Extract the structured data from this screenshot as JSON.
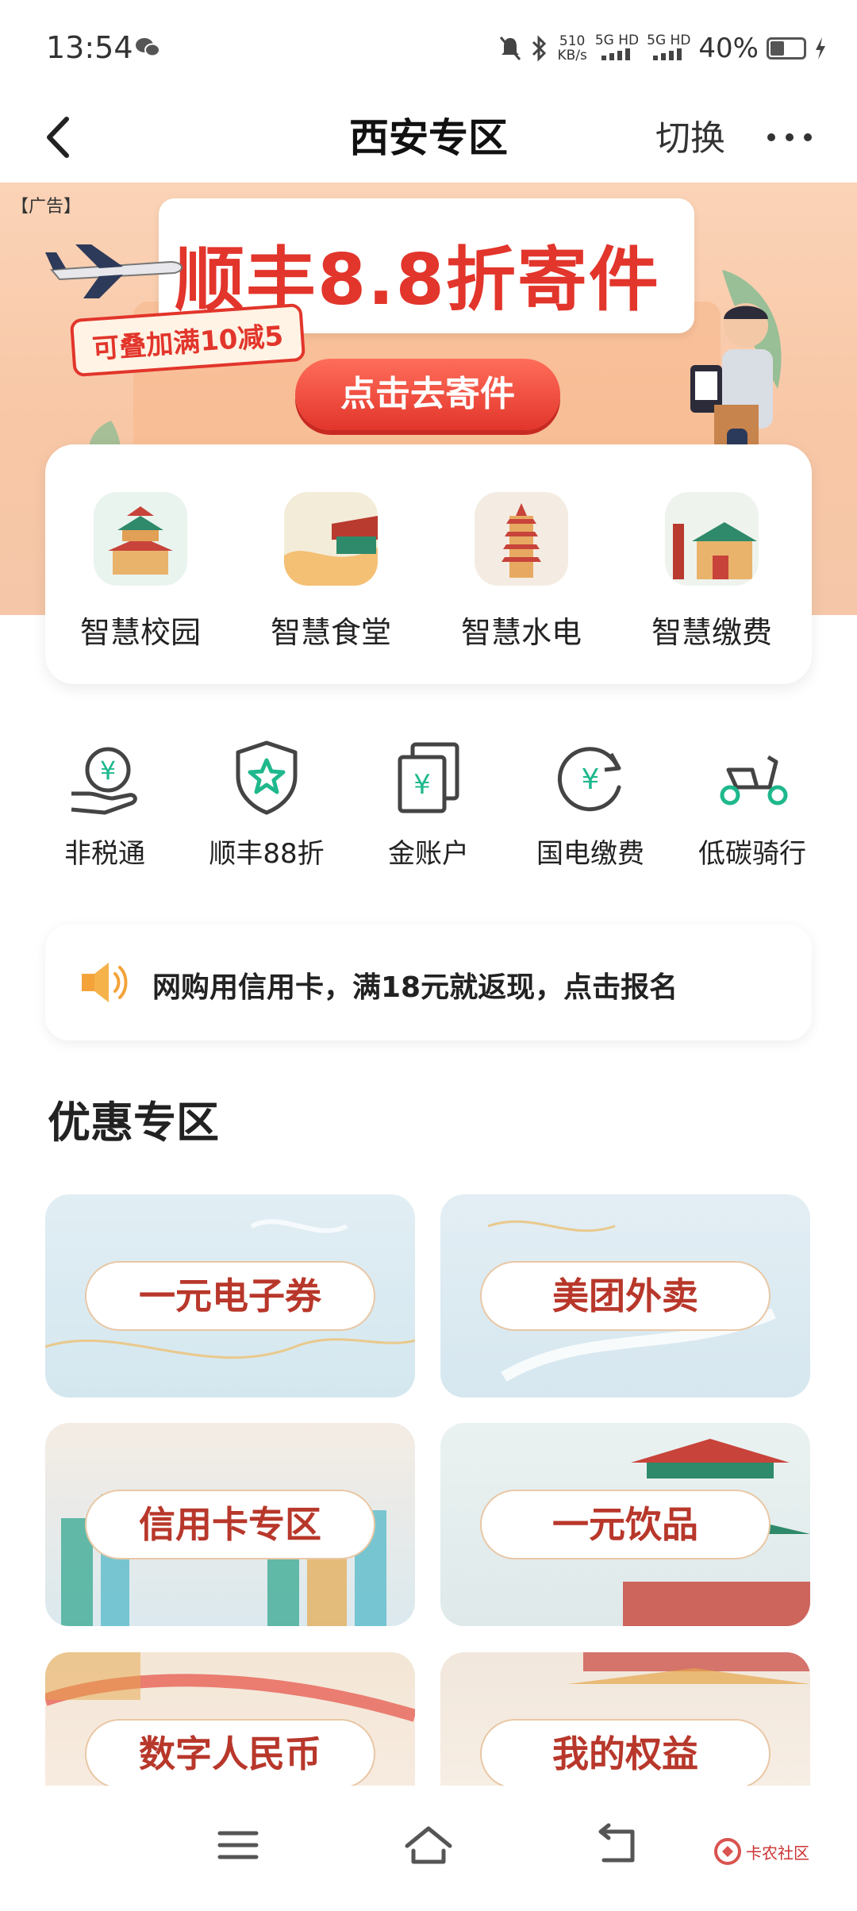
{
  "status_bar": {
    "time": "13:54",
    "net_speed_top": "510",
    "net_speed_bottom": "KB/s",
    "sig1": "5G HD",
    "sig2": "5G HD",
    "battery_pct": "40%"
  },
  "nav": {
    "title": "西安专区",
    "switch_label": "切换"
  },
  "banner": {
    "ad_tag": "【广告】",
    "title": "顺丰8.8折寄件",
    "badge": "可叠加满10减5",
    "cta": "点击去寄件"
  },
  "smart_services": [
    {
      "label": "智慧校园",
      "icon": "pagoda-campus-icon"
    },
    {
      "label": "智慧食堂",
      "icon": "palace-roof-icon"
    },
    {
      "label": "智慧水电",
      "icon": "wild-goose-pagoda-icon"
    },
    {
      "label": "智慧缴费",
      "icon": "city-gate-icon"
    }
  ],
  "quick_actions": [
    {
      "label": "非税通",
      "icon": "yuan-hand-icon"
    },
    {
      "label": "顺丰88折",
      "icon": "star-shield-icon"
    },
    {
      "label": "金账户",
      "icon": "yuan-cards-icon"
    },
    {
      "label": "国电缴费",
      "icon": "yuan-refresh-icon"
    },
    {
      "label": "低碳骑行",
      "icon": "scooter-icon"
    }
  ],
  "notice": {
    "text": "网购用信用卡，满18元就返现，点击报名",
    "icon": "speaker-icon"
  },
  "section": {
    "title": "优惠专区"
  },
  "promos": [
    {
      "label": "一元电子券"
    },
    {
      "label": "美团外卖"
    },
    {
      "label": "信用卡专区"
    },
    {
      "label": "一元饮品"
    },
    {
      "label": "数字人民币"
    },
    {
      "label": "我的权益"
    }
  ],
  "watermark": "卡农社区",
  "colors": {
    "accent_green": "#1fb88d",
    "brand_red": "#e2352b",
    "banner_bg": "#f8c7a6",
    "promo_text": "#b8372b"
  }
}
